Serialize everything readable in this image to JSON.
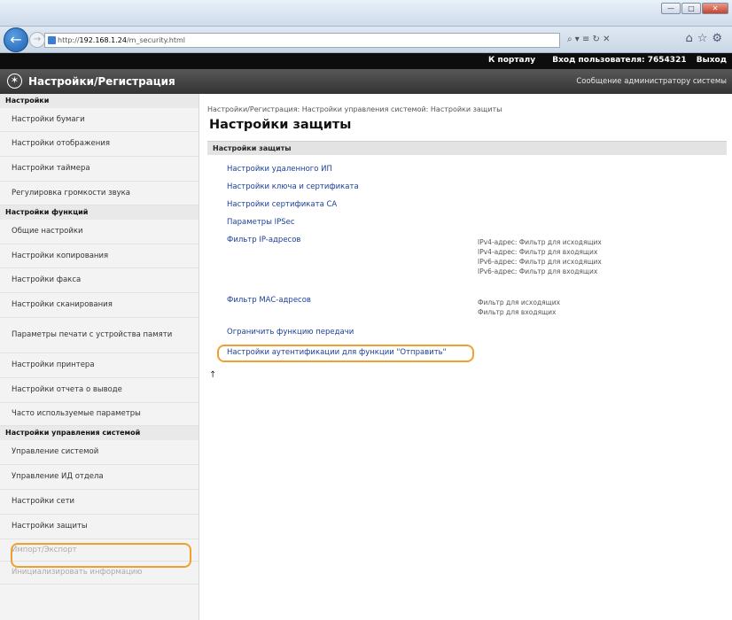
{
  "browser": {
    "url_prefix": "http://",
    "url_host": "192.168.1.24",
    "url_path": "/m_security.html",
    "nav_tools": "⌕ ▾ ≡ ↻ ✕",
    "icons": "⌂☆⚙",
    "win_min": "—",
    "win_max": "□",
    "win_close": "✕"
  },
  "device_header": {
    "device_name": "",
    "portal_link": "К порталу",
    "login_label": "Вход пользователя:  7654321",
    "logout_link": "Выход"
  },
  "app_header": {
    "title": "Настройки/Регистрация",
    "admin_message": "Сообщение администратору системы"
  },
  "sidebar": {
    "groups": [
      {
        "heading": "Настройки",
        "items": [
          {
            "label": "Настройки бумаги",
            "h": 27
          },
          {
            "label": "Настройки отображения",
            "h": 28
          },
          {
            "label": "Настройки таймера",
            "h": 28
          },
          {
            "label": "Регулировка громкости звука",
            "h": 27
          }
        ]
      },
      {
        "heading": "Настройки функций",
        "items": [
          {
            "label": "Общие настройки",
            "h": 28
          },
          {
            "label": "Настройки копирования",
            "h": 27
          },
          {
            "label": "Настройки факса",
            "h": 28
          },
          {
            "label": "Настройки сканирования",
            "h": 28
          },
          {
            "label": "Параметры печати с устройства памяти",
            "h": 40
          },
          {
            "label": "Настройки принтера",
            "h": 28
          },
          {
            "label": "Настройки отчета о выводе",
            "h": 28
          },
          {
            "label": "Часто используемые параметры",
            "h": 26
          }
        ]
      },
      {
        "heading": "Настройки управления системой",
        "items": [
          {
            "label": "Управление системой",
            "h": 28
          },
          {
            "label": "Управление ИД отдела",
            "h": 28
          },
          {
            "label": "Настройки сети",
            "h": 28
          },
          {
            "label": "Настройки защиты",
            "h": 28
          },
          {
            "label": "Импорт/Экспорт",
            "h": 25,
            "muted": true
          },
          {
            "label": "Инициализировать информацию",
            "h": 26,
            "muted": true
          }
        ]
      }
    ]
  },
  "main": {
    "breadcrumb": "Настройки/Регистрация: Настройки управления системой: Настройки защиты",
    "title": "Настройки защиты",
    "section_header": "Настройки защиты",
    "links": {
      "remote_ui": "Настройки удаленного ИП",
      "key_cert": "Настройки ключа и сертификата",
      "ca_cert": "Настройки сертификата CA",
      "ipsec": "Параметры IPSec",
      "ip_filter": "Фильтр IP-адресов",
      "mac_filter": "Фильтр MAC-адресов",
      "restrict_tx": "Ограничить функцию передачи",
      "send_auth": "Настройки аутентификации для функции \"Отправить\""
    },
    "ip_status": [
      "IPv4-адрес: Фильтр для исходящих",
      "IPv4-адрес: Фильтр для входящих",
      "IPv6-адрес: Фильтр для исходящих",
      "IPv6-адрес: Фильтр для входящих"
    ],
    "mac_status": [
      "Фильтр для исходящих",
      "Фильтр для входящих"
    ],
    "to_top": "↑"
  },
  "colors": {
    "highlight": "#f0a030",
    "link": "#1a3f9c"
  }
}
